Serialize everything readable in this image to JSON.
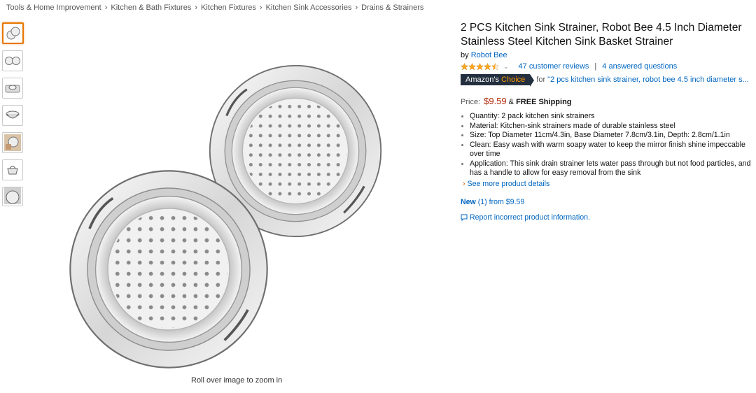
{
  "breadcrumb": [
    "Tools & Home Improvement",
    "Kitchen & Bath Fixtures",
    "Kitchen Fixtures",
    "Kitchen Sink Accessories",
    "Drains & Strainers"
  ],
  "breadcrumb_separator": "›",
  "thumbnails": [
    "two-strainers",
    "two-strainers-flat",
    "strainer-in-sink",
    "strainer-basket",
    "strainer-in-hand",
    "strainer-handle",
    "strainer-closeup"
  ],
  "zoom_hint": "Roll over image to zoom in",
  "product": {
    "title": "2 PCS Kitchen Sink Strainer, Robot Bee 4.5 Inch Diameter Stainless Steel Kitchen Sink Basket Strainer",
    "by_label": "by",
    "brand": "Robot Bee",
    "rating_stars": 4.5,
    "reviews": "47 customer reviews",
    "separator": "|",
    "questions": "4 answered questions",
    "choice_badge_part1": "Amazon's",
    "choice_badge_part2": "Choice",
    "choice_for": "for",
    "choice_query": "\"2 pcs kitchen sink strainer, robot bee 4.5 inch diameter s...",
    "price_label": "Price:",
    "price": "$9.59",
    "shipping_prefix": "&",
    "shipping": "FREE Shipping",
    "bullets": [
      "Quantity: 2 pack kitchen sink strainers",
      "Material: Kitchen-sink strainers made of durable stainless steel",
      "Size: Top Diameter 11cm/4.3in, Base Diameter 7.8cm/3.1in, Depth: 2.8cm/1.1in",
      "Clean: Easy wash with warm soapy water to keep the mirror finish shine impeccable over time",
      "Application: This sink drain strainer lets water pass through but not food particles, and has a handle to allow for easy removal from the sink"
    ],
    "see_more": "See more product details",
    "new_label": "New",
    "new_count": "(1)",
    "new_from": "from $9.59",
    "report": "Report incorrect product information."
  },
  "colors": {
    "link": "#0066c0",
    "price": "#b12704",
    "star": "#ffa41c",
    "badge_bg": "#232f3e",
    "badge_accent": "#ff9900",
    "selected_thumb": "#e77600"
  }
}
